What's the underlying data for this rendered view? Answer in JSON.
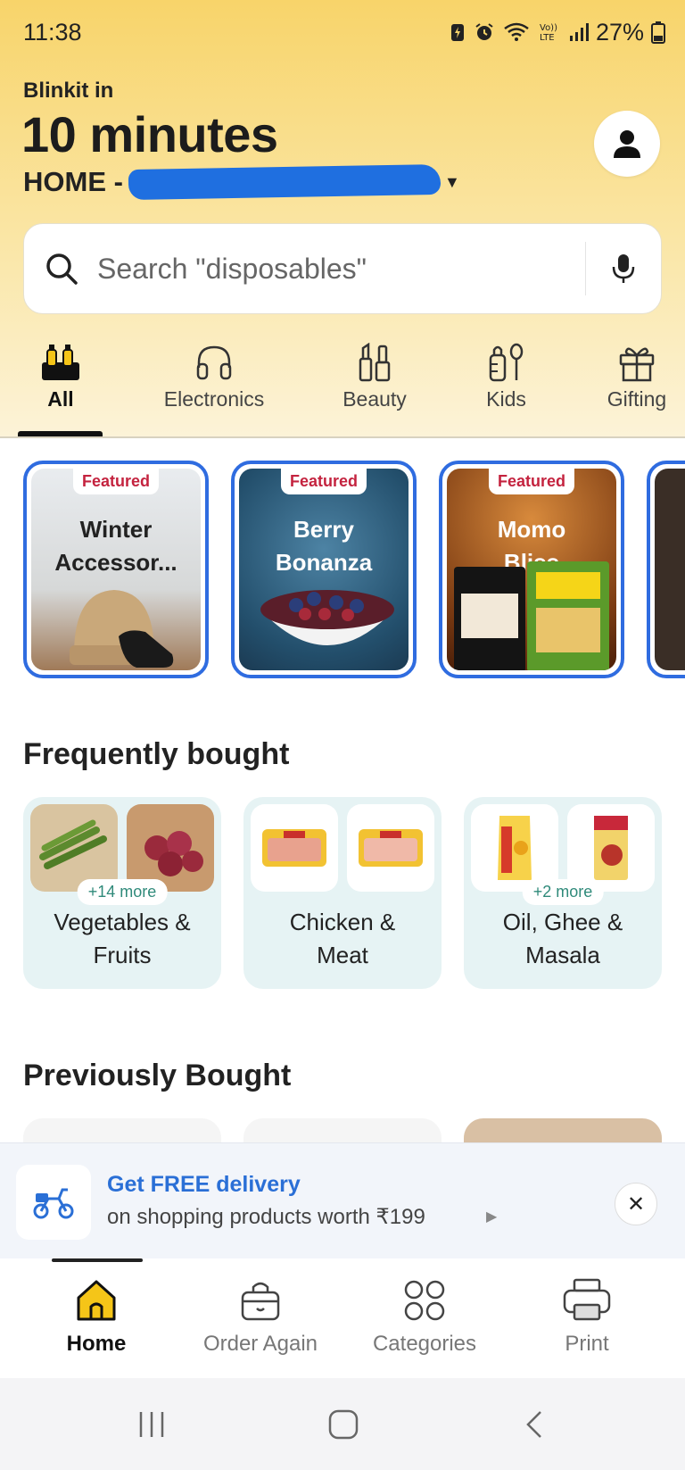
{
  "status_bar": {
    "time": "11:38",
    "battery": "27%",
    "icons": [
      "battery-saver-icon",
      "alarm-icon",
      "wifi-icon",
      "volte-icon",
      "signal-icon",
      "battery-icon"
    ]
  },
  "header": {
    "brand": "Blinkit in",
    "eta": "10 minutes",
    "address_prefix": "HOME - ",
    "profile_icon": "user-icon"
  },
  "search": {
    "placeholder": "Search \"disposables\"",
    "mic_icon": "mic-icon"
  },
  "categories": [
    {
      "label": "All",
      "icon": "bottles-icon",
      "active": true
    },
    {
      "label": "Electronics",
      "icon": "headphones-icon",
      "active": false
    },
    {
      "label": "Beauty",
      "icon": "cosmetics-icon",
      "active": false
    },
    {
      "label": "Kids",
      "icon": "baby-bottle-icon",
      "active": false
    },
    {
      "label": "Gifting",
      "icon": "gift-icon",
      "active": false
    }
  ],
  "featured": [
    {
      "tag": "Featured",
      "title_line1": "Winter",
      "title_line2": "Accessor..."
    },
    {
      "tag": "Featured",
      "title_line1": "Berry",
      "title_line2": "Bonanza"
    },
    {
      "tag": "Featured",
      "title_line1": "Momo",
      "title_line2": "Bliss"
    }
  ],
  "frequently_bought": {
    "title": "Frequently bought",
    "items": [
      {
        "more": "+14 more",
        "line1": "Vegetables &",
        "line2": "Fruits"
      },
      {
        "more": "",
        "line1": "Chicken &",
        "line2": "Meat"
      },
      {
        "more": "+2 more",
        "line1": "Oil, Ghee &",
        "line2": "Masala"
      }
    ]
  },
  "previously_bought": {
    "title": "Previously Bought"
  },
  "delivery_banner": {
    "title": "Get FREE delivery",
    "subtitle": "on shopping products worth ₹199",
    "close": "✕"
  },
  "bottom_nav": [
    {
      "label": "Home",
      "icon": "home-icon",
      "active": true
    },
    {
      "label": "Order Again",
      "icon": "basket-icon",
      "active": false
    },
    {
      "label": "Categories",
      "icon": "grid-icon",
      "active": false
    },
    {
      "label": "Print",
      "icon": "printer-icon",
      "active": false
    }
  ],
  "colors": {
    "header_gradient_top": "#f8d46a",
    "accent_blue": "#2f6ce0",
    "featured_tag": "#c4233f",
    "frequent_bg": "#e6f3f4",
    "home_icon_fill": "#f5c518"
  }
}
